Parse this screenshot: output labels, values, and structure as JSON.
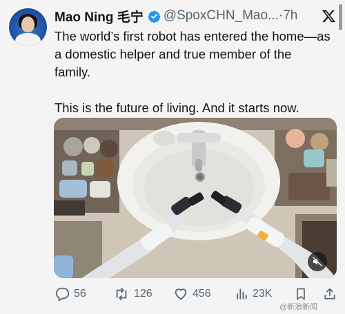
{
  "author": {
    "name": "Mao Ning 毛宁",
    "handle": "@SpoxCHN_Mao...",
    "time": "·7h"
  },
  "tweet": {
    "line1": "The world’s first robot has entered the home—as a domestic helper and true member of the family.",
    "line2": "This is the future of living. And it starts now."
  },
  "actions": {
    "replies": "56",
    "retweets": "126",
    "likes": "456",
    "views": "23K"
  },
  "watermark": "@新浪新闻",
  "colors": {
    "verified": "#1d9bf0",
    "text": "#0f1419",
    "muted": "#536471"
  },
  "icons": [
    "verified-badge-icon",
    "x-logo-icon",
    "mute-icon",
    "reply-icon",
    "retweet-icon",
    "like-icon",
    "views-icon",
    "bookmark-icon",
    "share-icon"
  ]
}
